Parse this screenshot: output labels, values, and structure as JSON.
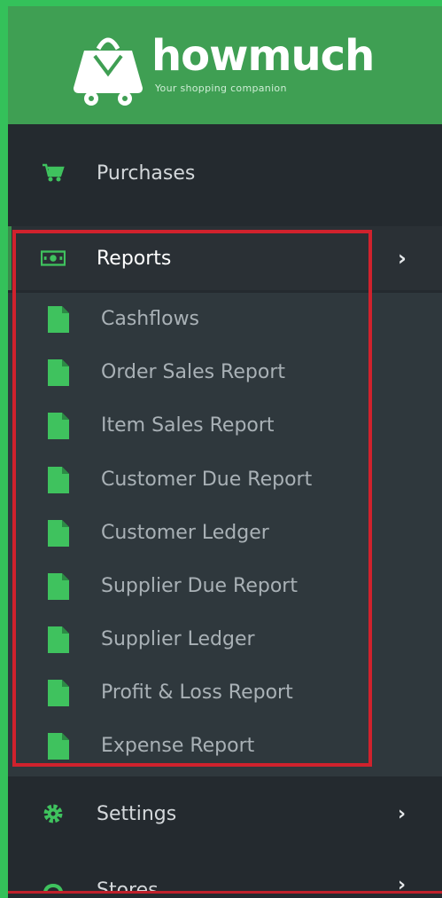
{
  "brand": {
    "name": "howmuch",
    "tagline": "Your shopping companion"
  },
  "nav": {
    "purchases": {
      "label": "Purchases",
      "icon": "cart-icon"
    },
    "reports": {
      "label": "Reports",
      "icon": "money-icon",
      "expanded": true
    },
    "settings": {
      "label": "Settings",
      "icon": "gear-icon"
    },
    "stores": {
      "label": "Stores",
      "icon": "store-icon"
    }
  },
  "reports_submenu": [
    {
      "label": "Cashflows",
      "icon": "document-icon"
    },
    {
      "label": "Order Sales Report",
      "icon": "document-icon"
    },
    {
      "label": "Item Sales Report",
      "icon": "document-icon"
    },
    {
      "label": "Customer Due Report",
      "icon": "document-icon"
    },
    {
      "label": "Customer Ledger",
      "icon": "document-icon"
    },
    {
      "label": "Supplier Due Report",
      "icon": "document-icon"
    },
    {
      "label": "Supplier Ledger",
      "icon": "document-icon"
    },
    {
      "label": "Profit & Loss Report",
      "icon": "document-icon"
    },
    {
      "label": "Expense Report",
      "icon": "document-icon"
    }
  ],
  "colors": {
    "brand_green": "#3f9f53",
    "icon_green": "#3fc25e",
    "sidebar_bg": "#242a2f",
    "submenu_bg": "#2f383d",
    "highlight_red": "#d0222d"
  }
}
